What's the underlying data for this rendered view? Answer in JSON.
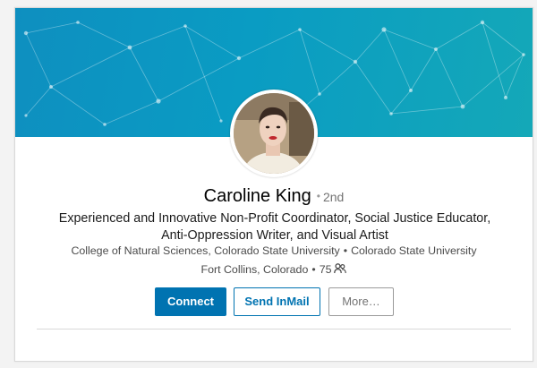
{
  "profile": {
    "name": "Caroline King",
    "degree": "2nd",
    "headline": "Experienced and Innovative Non-Profit Coordinator, Social Justice Educator, Anti-Oppression Writer, and Visual Artist",
    "education_school": "College of Natural Sciences, Colorado State University",
    "education_university": "Colorado State University",
    "location": "Fort Collins, Colorado",
    "connections": "75"
  },
  "actions": {
    "connect_label": "Connect",
    "inmail_label": "Send InMail",
    "more_label": "More…"
  },
  "icons": {
    "connections": "people-icon"
  },
  "colors": {
    "accent": "#0073b1",
    "banner_start": "#0e8fc0",
    "banner_end": "#14a8b8"
  }
}
